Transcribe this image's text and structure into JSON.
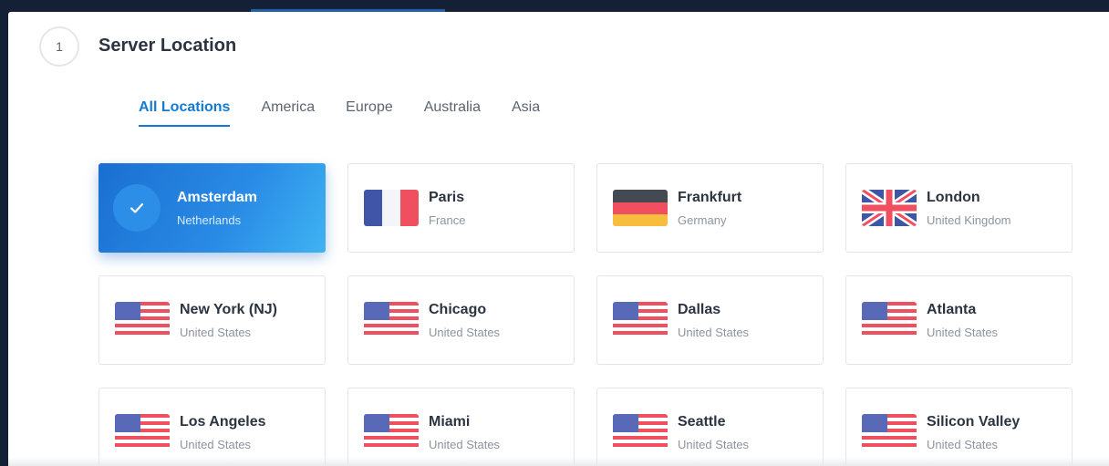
{
  "step": {
    "number": "1",
    "title": "Server Location"
  },
  "tabs": [
    {
      "label": "All Locations",
      "active": true
    },
    {
      "label": "America",
      "active": false
    },
    {
      "label": "Europe",
      "active": false
    },
    {
      "label": "Australia",
      "active": false
    },
    {
      "label": "Asia",
      "active": false
    }
  ],
  "locations": [
    {
      "city": "Amsterdam",
      "country": "Netherlands",
      "flag": "check-icon",
      "selected": true
    },
    {
      "city": "Paris",
      "country": "France",
      "flag": "france-flag-icon"
    },
    {
      "city": "Frankfurt",
      "country": "Germany",
      "flag": "germany-flag-icon"
    },
    {
      "city": "London",
      "country": "United Kingdom",
      "flag": "uk-flag-icon"
    },
    {
      "city": "New York (NJ)",
      "country": "United States",
      "flag": "us-flag-icon"
    },
    {
      "city": "Chicago",
      "country": "United States",
      "flag": "us-flag-icon"
    },
    {
      "city": "Dallas",
      "country": "United States",
      "flag": "us-flag-icon"
    },
    {
      "city": "Atlanta",
      "country": "United States",
      "flag": "us-flag-icon"
    },
    {
      "city": "Los Angeles",
      "country": "United States",
      "flag": "us-flag-icon"
    },
    {
      "city": "Miami",
      "country": "United States",
      "flag": "us-flag-icon"
    },
    {
      "city": "Seattle",
      "country": "United States",
      "flag": "us-flag-icon"
    },
    {
      "city": "Silicon Valley",
      "country": "United States",
      "flag": "us-flag-icon"
    }
  ],
  "colors": {
    "accent": "#1479d4",
    "page_background": "#142035"
  }
}
